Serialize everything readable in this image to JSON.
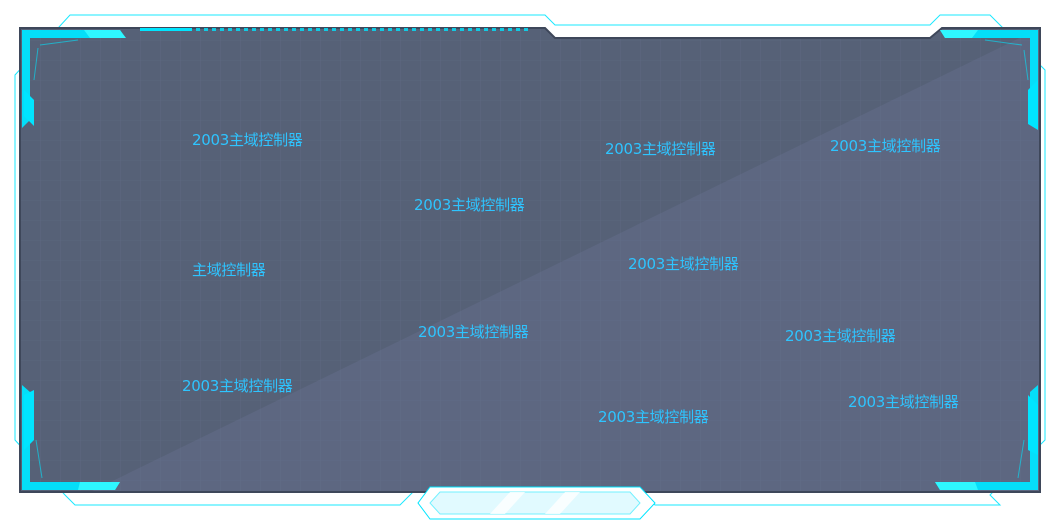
{
  "theme": {
    "accent": "#00e5ff",
    "panel_bg": "#566177",
    "label_color": "#2ec4ff"
  },
  "nodes": [
    {
      "id": "n1",
      "label": "2003主域控制器"
    },
    {
      "id": "n2",
      "label": "2003主域控制器"
    },
    {
      "id": "n3",
      "label": "2003主域控制器"
    },
    {
      "id": "n4",
      "label": "2003主域控制器"
    },
    {
      "id": "n5",
      "label": "主域控制器"
    },
    {
      "id": "n6",
      "label": "2003主域控制器"
    },
    {
      "id": "n7",
      "label": "2003主域控制器"
    },
    {
      "id": "n8",
      "label": "2003主域控制器"
    },
    {
      "id": "n9",
      "label": "2003主域控制器"
    },
    {
      "id": "n10",
      "label": "2003主域控制器"
    },
    {
      "id": "n11",
      "label": "2003主域控制器"
    }
  ]
}
